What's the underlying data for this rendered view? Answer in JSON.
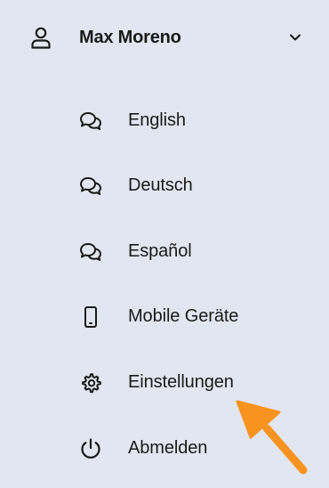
{
  "user": {
    "name": "Max Moreno",
    "icon": "user-icon",
    "toggle_icon": "chevron-down-icon"
  },
  "menu_items": [
    {
      "label": "English",
      "icon": "chat-bubbles-icon"
    },
    {
      "label": "Deutsch",
      "icon": "chat-bubbles-icon"
    },
    {
      "label": "Español",
      "icon": "chat-bubbles-icon"
    },
    {
      "label": "Mobile Geräte",
      "icon": "mobile-phone-icon"
    },
    {
      "label": "Einstellungen",
      "icon": "gear-icon"
    },
    {
      "label": "Abmelden",
      "icon": "power-icon"
    }
  ],
  "colors": {
    "background": "#e2e6f0",
    "text": "#1a1a1a",
    "arrow": "#f7931e"
  }
}
